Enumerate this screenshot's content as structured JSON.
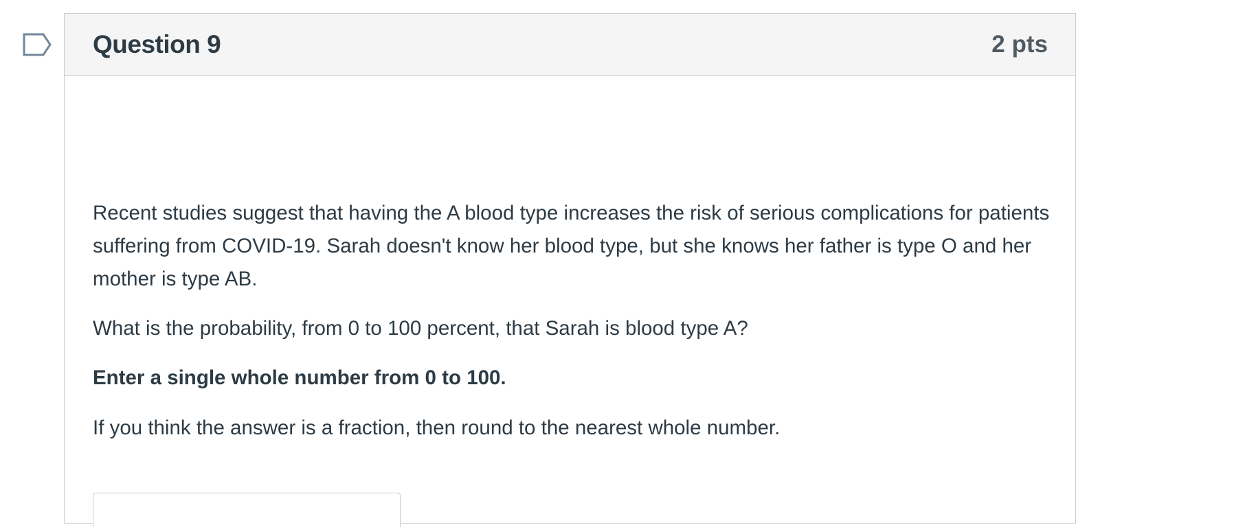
{
  "question": {
    "title": "Question 9",
    "points": "2 pts",
    "flag_icon": "bookmark-flag-icon",
    "paragraphs": [
      "Recent studies suggest that having the A blood type increases the risk of serious complications for patients suffering from COVID-19.  Sarah doesn't know her blood type, but she knows her father is type O and her mother is type AB.",
      "What is the probability, from 0 to 100 percent, that Sarah is blood type A?",
      "Enter a single whole number from 0 to 100.",
      "If you think the answer is a fraction, then round to the nearest whole number."
    ],
    "answer": {
      "value": "",
      "placeholder": ""
    }
  },
  "colors": {
    "text": "#2d3b45",
    "border": "#c7cdd1",
    "header_bg": "#f5f5f5",
    "flag_stroke": "#73879a"
  }
}
